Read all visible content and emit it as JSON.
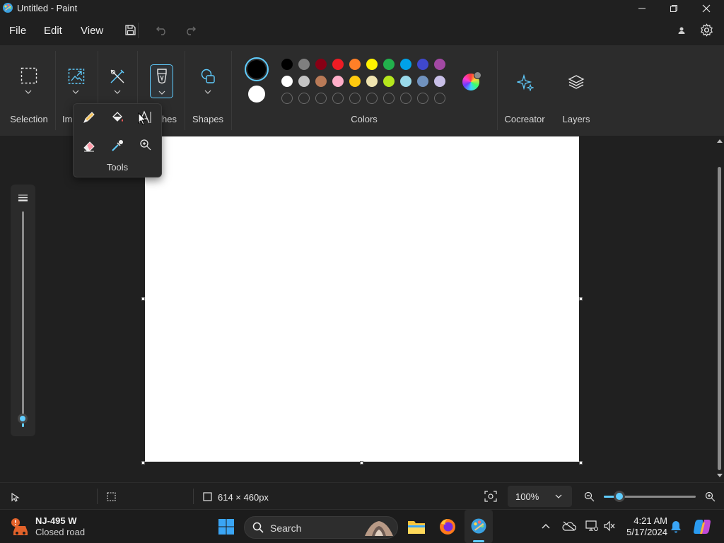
{
  "window": {
    "title": "Untitled - Paint"
  },
  "menu": {
    "file": "File",
    "edit": "Edit",
    "view": "View"
  },
  "ribbon": {
    "selection": "Selection",
    "image": "Im",
    "brushes": "hes",
    "shapes": "Shapes",
    "colors": "Colors",
    "cocreator": "Cocreator",
    "layers": "Layers"
  },
  "tools_popup": {
    "label": "Tools"
  },
  "palette": {
    "primary": "#000000",
    "secondary": "#ffffff",
    "row1": [
      "#000000",
      "#7f7f7f",
      "#880015",
      "#ed1c24",
      "#ff7f27",
      "#fff200",
      "#22b14c",
      "#00a2e8",
      "#3f48cc",
      "#a349a4"
    ],
    "row2": [
      "#ffffff",
      "#c3c3c3",
      "#b97a57",
      "#ffaec9",
      "#ffc90e",
      "#efe4b0",
      "#b5e61d",
      "#99d9ea",
      "#7092be",
      "#c8bfe7"
    ],
    "accent": "#60cdff"
  },
  "status": {
    "canvas_size": "614 × 460px",
    "zoom": "100%",
    "zoom_level_fraction": 0.1
  },
  "brush_size_fraction": 0.04,
  "taskbar": {
    "weather_title": "NJ-495 W",
    "weather_sub": "Closed road",
    "search_placeholder": "Search",
    "time": "4:21 AM",
    "date": "5/17/2024"
  }
}
